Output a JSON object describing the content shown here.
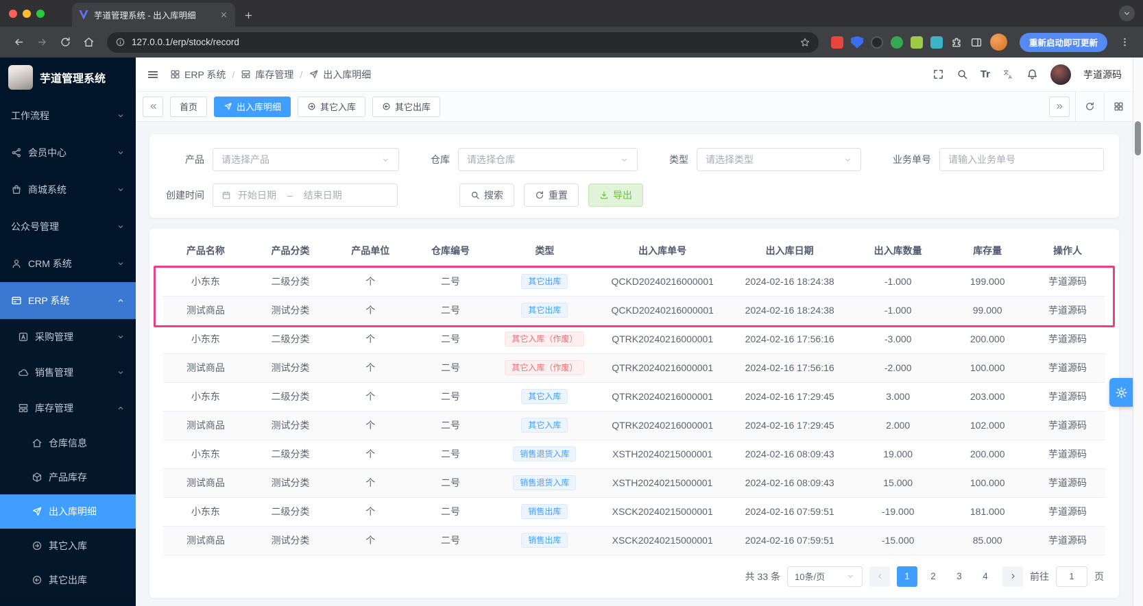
{
  "colors": {
    "accent": "#409eff",
    "highlight": "#ed3f87",
    "success": "#67c23a",
    "danger": "#f56c6c"
  },
  "browser": {
    "tab_title": "芋道管理系统 - 出入库明细",
    "url": "127.0.0.1/erp/stock/record",
    "update_button_label": "重新启动即可更新"
  },
  "sidebar": {
    "logo_title": "芋道管理系统",
    "items": [
      {
        "label": "工作流程",
        "level": 1,
        "icon": null,
        "chevron": "down",
        "active": false
      },
      {
        "label": "会员中心",
        "level": 1,
        "icon": "share",
        "chevron": "down",
        "active": false
      },
      {
        "label": "商城系统",
        "level": 1,
        "icon": "shop",
        "chevron": "down",
        "active": false
      },
      {
        "label": "公众号管理",
        "level": 1,
        "icon": null,
        "chevron": "down",
        "active": false
      },
      {
        "label": "CRM 系统",
        "level": 1,
        "icon": "user",
        "chevron": "down",
        "active": false
      },
      {
        "label": "ERP 系统",
        "level": 1,
        "icon": "card",
        "chevron": "up",
        "active": true
      },
      {
        "label": "采购管理",
        "level": 2,
        "icon": "square-a",
        "chevron": "down",
        "active": false
      },
      {
        "label": "销售管理",
        "level": 2,
        "icon": "cloud",
        "chevron": "down",
        "active": false
      },
      {
        "label": "库存管理",
        "level": 2,
        "icon": "layers",
        "chevron": "up",
        "active": false
      },
      {
        "label": "仓库信息",
        "level": 3,
        "icon": "home",
        "chevron": null,
        "active": false
      },
      {
        "label": "产品库存",
        "level": 3,
        "icon": "cube",
        "chevron": null,
        "active": false
      },
      {
        "label": "出入库明细",
        "level": 3,
        "icon": "send",
        "chevron": null,
        "active": true
      },
      {
        "label": "其它入库",
        "level": 3,
        "icon": "circle-in",
        "chevron": null,
        "active": false
      },
      {
        "label": "其它出库",
        "level": 3,
        "icon": "circle-out",
        "chevron": null,
        "active": false
      }
    ]
  },
  "navbar": {
    "breadcrumb": [
      {
        "icon": "grid4",
        "label": "ERP 系统"
      },
      {
        "icon": "layers",
        "label": "库存管理"
      },
      {
        "icon": "send",
        "label": "出入库明细"
      }
    ],
    "breadcrumb_separator": "/",
    "font_size_text": "Tr",
    "username": "芋道源码"
  },
  "tagsview": {
    "tabs": [
      {
        "label": "首页",
        "icon": null,
        "active": false
      },
      {
        "label": "出入库明细",
        "icon": "send",
        "active": true
      },
      {
        "label": "其它入库",
        "icon": "circle-in",
        "active": false
      },
      {
        "label": "其它出库",
        "icon": "circle-out",
        "active": false
      }
    ]
  },
  "filters": {
    "product": {
      "label": "产品",
      "placeholder": "请选择产品"
    },
    "warehouse": {
      "label": "仓库",
      "placeholder": "请选择仓库"
    },
    "type": {
      "label": "类型",
      "placeholder": "请选择类型"
    },
    "biz_no": {
      "label": "业务单号",
      "placeholder": "请输入业务单号"
    },
    "create_time": {
      "label": "创建时间",
      "start_placeholder": "开始日期",
      "separator": "–",
      "end_placeholder": "结束日期"
    },
    "search_label": "搜索",
    "reset_label": "重置",
    "export_label": "导出"
  },
  "table": {
    "columns": [
      "产品名称",
      "产品分类",
      "产品单位",
      "仓库编号",
      "类型",
      "出入库单号",
      "出入库日期",
      "出入库数量",
      "库存量",
      "操作人"
    ],
    "rows": [
      {
        "product": "小东东",
        "category": "二级分类",
        "unit": "个",
        "warehouse": "二号",
        "type": "其它出库",
        "type_variant": "blue",
        "order_no": "QCKD20240216000001",
        "date": "2024-02-16 18:24:38",
        "qty": "-1.000",
        "stock": "199.000",
        "operator": "芋道源码"
      },
      {
        "product": "测试商品",
        "category": "测试分类",
        "unit": "个",
        "warehouse": "二号",
        "type": "其它出库",
        "type_variant": "blue",
        "order_no": "QCKD20240216000001",
        "date": "2024-02-16 18:24:38",
        "qty": "-1.000",
        "stock": "99.000",
        "operator": "芋道源码"
      },
      {
        "product": "小东东",
        "category": "二级分类",
        "unit": "个",
        "warehouse": "二号",
        "type": "其它入库（作废）",
        "type_variant": "red",
        "order_no": "QTRK20240216000001",
        "date": "2024-02-16 17:56:16",
        "qty": "-3.000",
        "stock": "200.000",
        "operator": "芋道源码"
      },
      {
        "product": "测试商品",
        "category": "测试分类",
        "unit": "个",
        "warehouse": "二号",
        "type": "其它入库（作废）",
        "type_variant": "red",
        "order_no": "QTRK20240216000001",
        "date": "2024-02-16 17:56:16",
        "qty": "-2.000",
        "stock": "100.000",
        "operator": "芋道源码"
      },
      {
        "product": "小东东",
        "category": "二级分类",
        "unit": "个",
        "warehouse": "二号",
        "type": "其它入库",
        "type_variant": "blue",
        "order_no": "QTRK20240216000001",
        "date": "2024-02-16 17:29:45",
        "qty": "3.000",
        "stock": "203.000",
        "operator": "芋道源码"
      },
      {
        "product": "测试商品",
        "category": "测试分类",
        "unit": "个",
        "warehouse": "二号",
        "type": "其它入库",
        "type_variant": "blue",
        "order_no": "QTRK20240216000001",
        "date": "2024-02-16 17:29:45",
        "qty": "2.000",
        "stock": "102.000",
        "operator": "芋道源码"
      },
      {
        "product": "小东东",
        "category": "二级分类",
        "unit": "个",
        "warehouse": "二号",
        "type": "销售退货入库",
        "type_variant": "blue",
        "order_no": "XSTH20240215000001",
        "date": "2024-02-16 08:09:43",
        "qty": "19.000",
        "stock": "200.000",
        "operator": "芋道源码"
      },
      {
        "product": "测试商品",
        "category": "测试分类",
        "unit": "个",
        "warehouse": "二号",
        "type": "销售退货入库",
        "type_variant": "blue",
        "order_no": "XSTH20240215000001",
        "date": "2024-02-16 08:09:43",
        "qty": "15.000",
        "stock": "100.000",
        "operator": "芋道源码"
      },
      {
        "product": "小东东",
        "category": "二级分类",
        "unit": "个",
        "warehouse": "二号",
        "type": "销售出库",
        "type_variant": "blue",
        "order_no": "XSCK20240215000001",
        "date": "2024-02-16 07:59:51",
        "qty": "-19.000",
        "stock": "181.000",
        "operator": "芋道源码"
      },
      {
        "product": "测试商品",
        "category": "测试分类",
        "unit": "个",
        "warehouse": "二号",
        "type": "销售出库",
        "type_variant": "blue",
        "order_no": "XSCK20240215000001",
        "date": "2024-02-16 07:59:51",
        "qty": "-15.000",
        "stock": "85.000",
        "operator": "芋道源码"
      }
    ],
    "highlighted_rows": [
      0,
      1
    ]
  },
  "pagination": {
    "total_text": "共 33 条",
    "page_size_value": "10条/页",
    "pages": [
      "1",
      "2",
      "3",
      "4"
    ],
    "active_page": "1",
    "goto_label": "前往",
    "goto_value": "1",
    "goto_unit": "页"
  }
}
